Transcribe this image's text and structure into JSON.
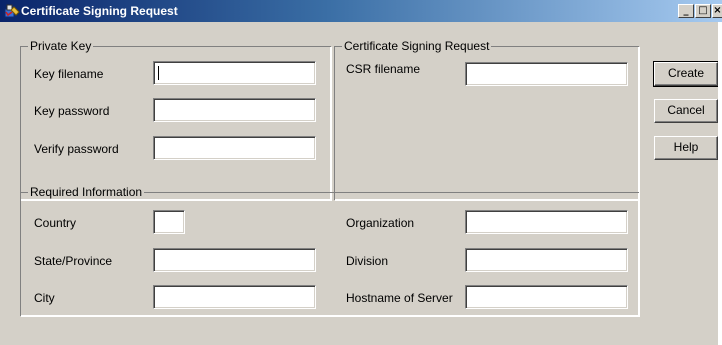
{
  "window": {
    "title": "Certificate Signing Request",
    "controls": {
      "minimize": "_",
      "maximize": "□",
      "close": "×"
    }
  },
  "private_key": {
    "legend": "Private Key",
    "key_filename": {
      "label": "Key filename",
      "value": ""
    },
    "key_password": {
      "label": "Key password",
      "value": ""
    },
    "verify_password": {
      "label": "Verify password",
      "value": ""
    }
  },
  "csr": {
    "legend": "Certificate Signing Request",
    "csr_filename": {
      "label": "CSR filename",
      "value": ""
    }
  },
  "required_info": {
    "legend": "Required Information",
    "country": {
      "label": "Country",
      "value": ""
    },
    "state": {
      "label": "State/Province",
      "value": ""
    },
    "city": {
      "label": "City",
      "value": ""
    },
    "organization": {
      "label": "Organization",
      "value": ""
    },
    "division": {
      "label": "Division",
      "value": ""
    },
    "hostname": {
      "label": "Hostname of Server",
      "value": ""
    }
  },
  "buttons": {
    "create": "Create",
    "cancel": "Cancel",
    "help": "Help"
  }
}
